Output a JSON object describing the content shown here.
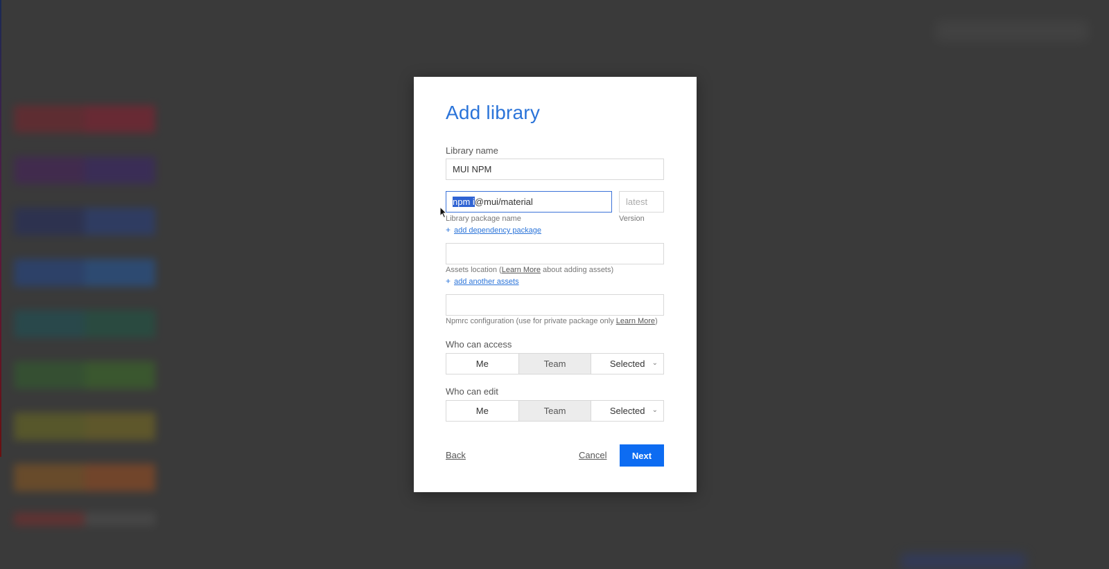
{
  "dialog": {
    "title": "Add library",
    "library_name_label": "Library name",
    "library_name_value": "MUI NPM",
    "package_selected": "npm i ",
    "package_rest": "@mui/material",
    "package_label": "Library package name",
    "version_placeholder": "latest",
    "version_label": "Version",
    "add_dependency": "add dependency package",
    "assets_help_prefix": "Assets location (",
    "assets_help_link": "Learn More",
    "assets_help_suffix": " about adding assets)",
    "add_assets": "add another assets",
    "npmrc_help_prefix": "Npmrc configuration (use for private package only ",
    "npmrc_help_link": "Learn More",
    "npmrc_help_suffix": ")",
    "access_label": "Who can access",
    "access_options": [
      "Me",
      "Team",
      "Selected"
    ],
    "edit_label": "Who can edit",
    "edit_options": [
      "Me",
      "Team",
      "Selected"
    ],
    "back": "Back",
    "cancel": "Cancel",
    "next": "Next",
    "plus": "+"
  },
  "colors": {
    "accent": "#2b74d9",
    "primary_button": "#0d6cf2",
    "overlay": "#3a3a3a"
  }
}
